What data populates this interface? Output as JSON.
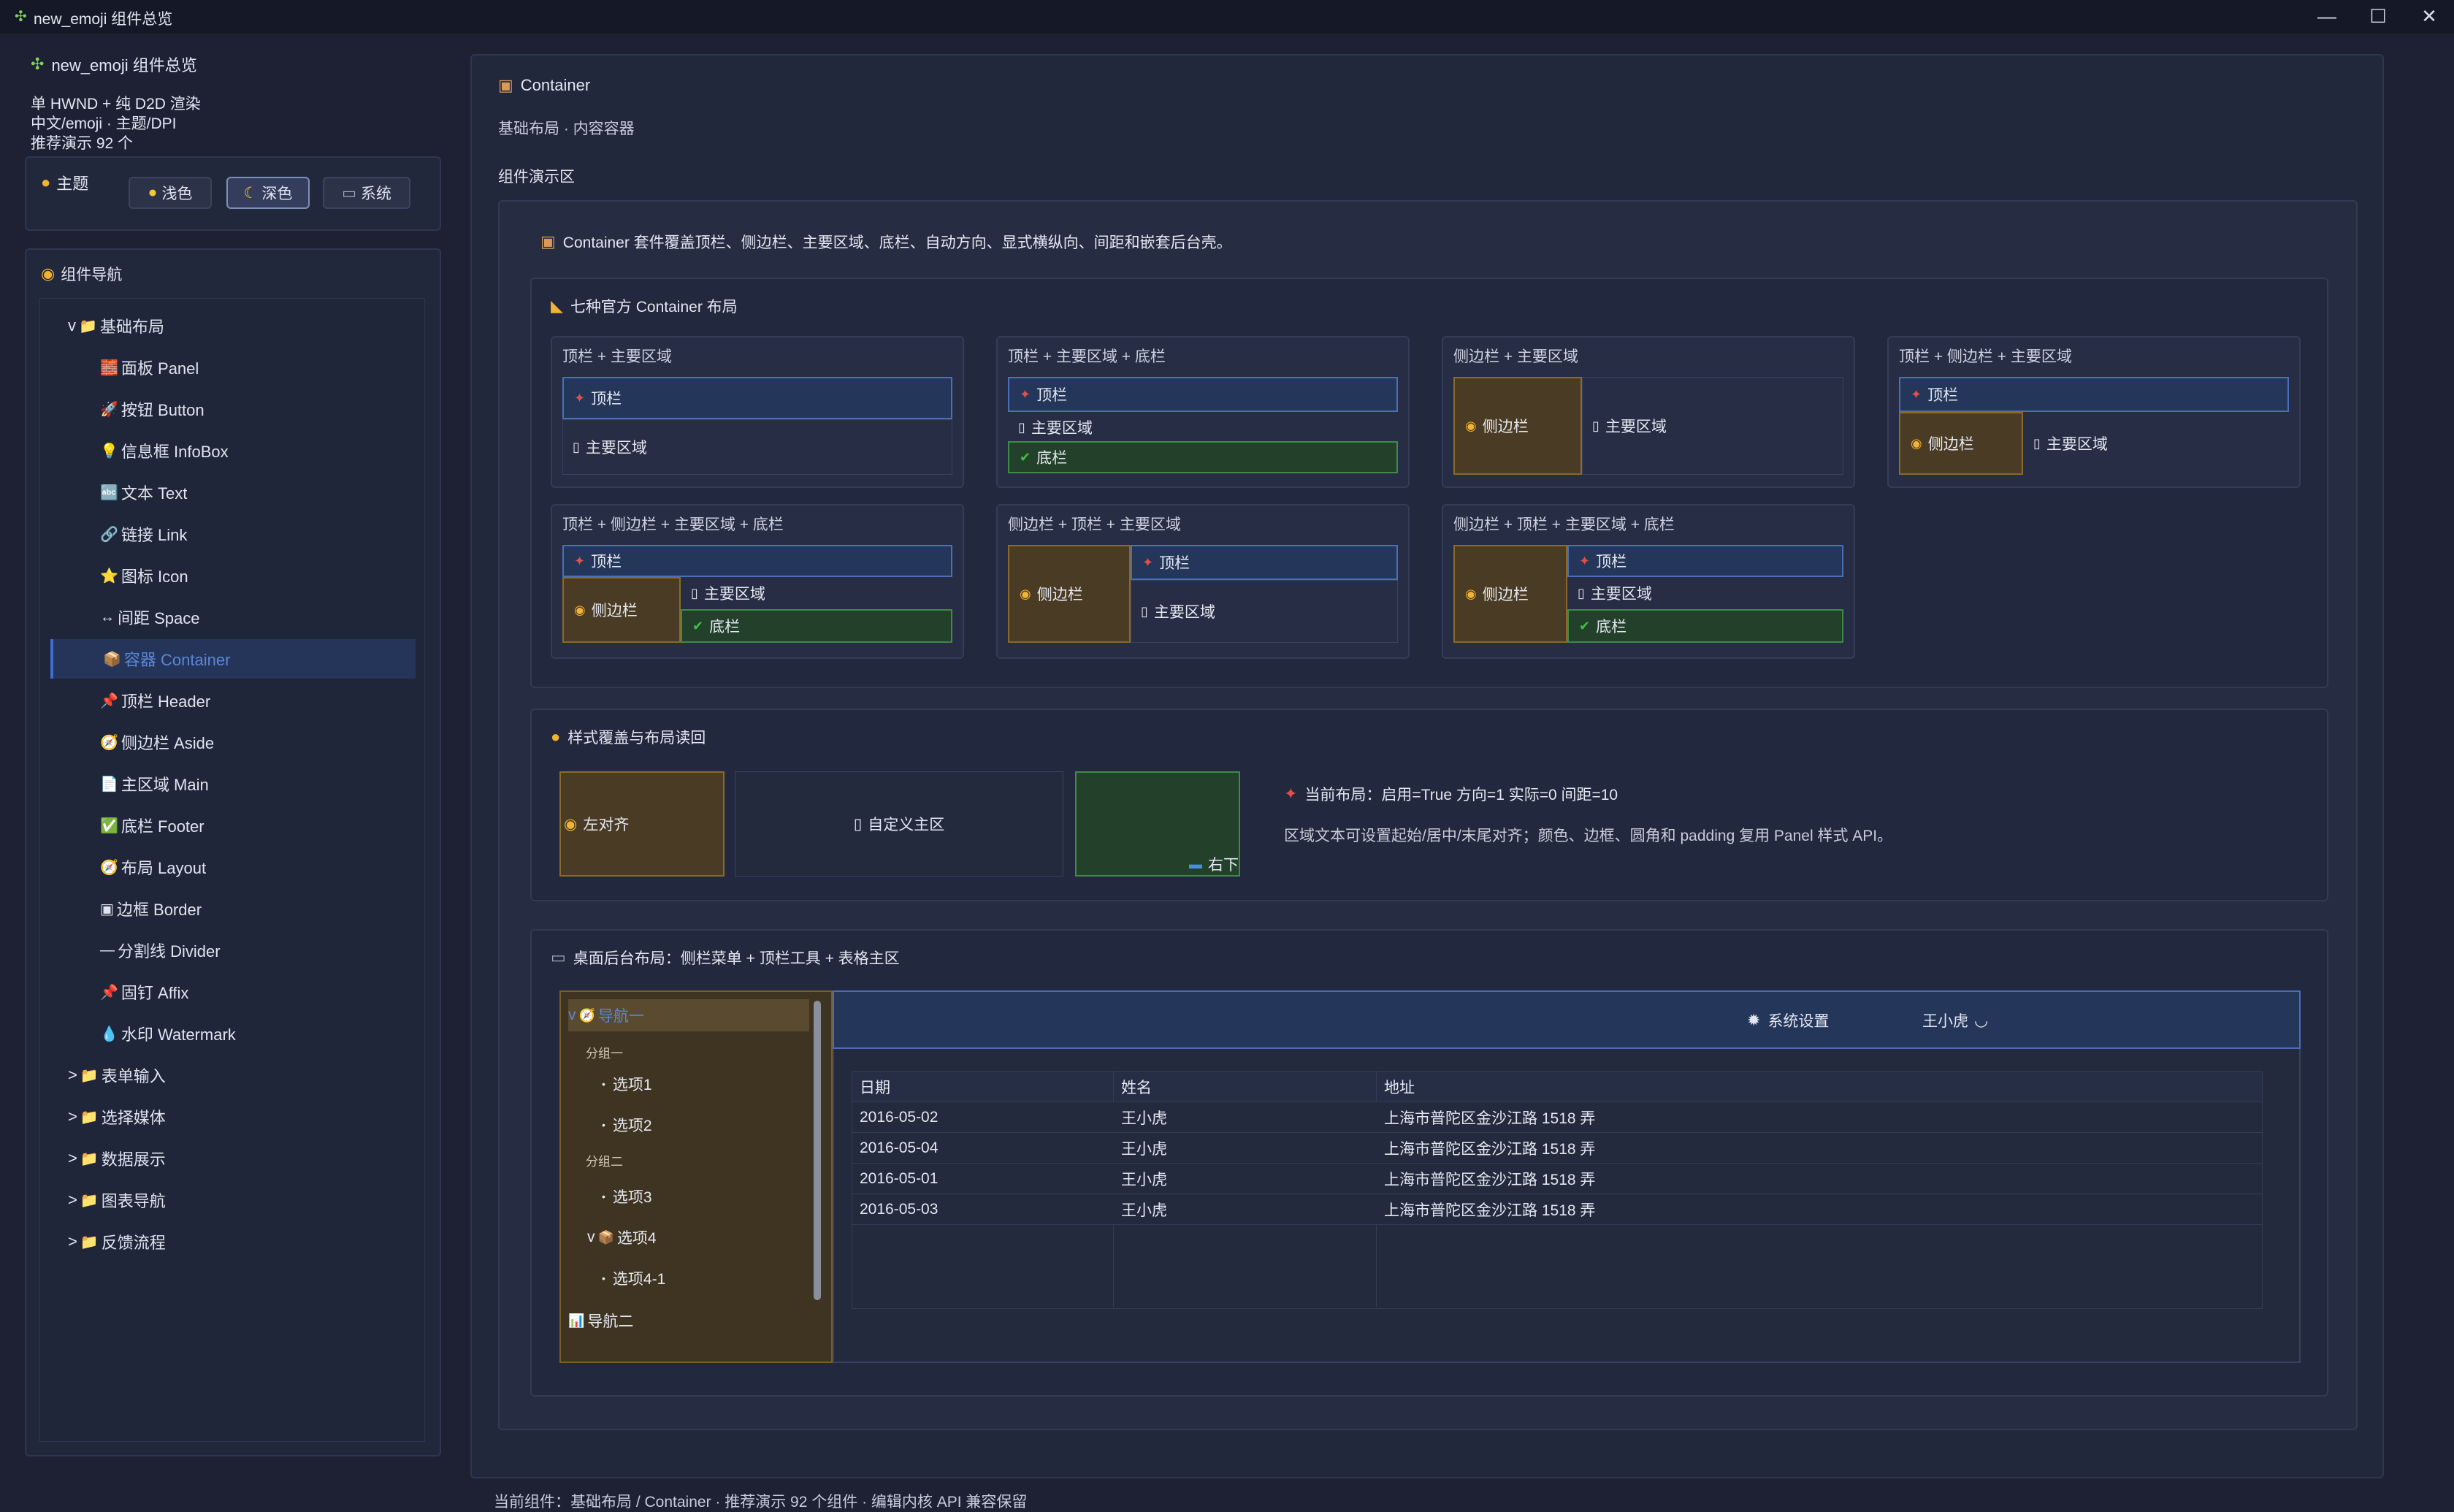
{
  "window": {
    "title": "new_emoji 组件总览",
    "icon": "puzzle-icon",
    "minimize": "—",
    "maximize": "☐",
    "close": "✕"
  },
  "sidebar": {
    "app_title": "new_emoji 组件总览",
    "desc1": "单 HWND + 纯 D2D 渲染",
    "desc2": "中文/emoji · 主题/DPI",
    "desc3": "推荐演示 92 个",
    "theme": {
      "title": "主题",
      "light": "浅色",
      "dark": "深色",
      "system": "系统",
      "selected": "深色"
    },
    "nav_title": "组件导航",
    "nav": [
      {
        "label": "基础布局",
        "prefix": "v",
        "icon": "📁",
        "group": true
      },
      {
        "label": "面板 Panel",
        "icon": "🧱"
      },
      {
        "label": "按钮 Button",
        "icon": "🚀"
      },
      {
        "label": "信息框 InfoBox",
        "icon": "💡"
      },
      {
        "label": "文本 Text",
        "icon": "🔤"
      },
      {
        "label": "链接 Link",
        "icon": "🔗"
      },
      {
        "label": "图标 Icon",
        "icon": "⭐"
      },
      {
        "label": "间距 Space",
        "icon": "↔"
      },
      {
        "label": "容器 Container",
        "icon": "📦",
        "selected": true
      },
      {
        "label": "顶栏 Header",
        "icon": "📌"
      },
      {
        "label": "侧边栏 Aside",
        "icon": "🧭"
      },
      {
        "label": "主区域 Main",
        "icon": "📄"
      },
      {
        "label": "底栏 Footer",
        "icon": "✅"
      },
      {
        "label": "布局 Layout",
        "icon": "🧭"
      },
      {
        "label": "边框 Border",
        "icon": "▣"
      },
      {
        "label": "分割线 Divider",
        "icon": "—"
      },
      {
        "label": "固钉 Affix",
        "icon": "📌"
      },
      {
        "label": "水印 Watermark",
        "icon": "💧"
      },
      {
        "label": "表单输入",
        "prefix": ">",
        "icon": "📁",
        "group": true
      },
      {
        "label": "选择媒体",
        "prefix": ">",
        "icon": "📁",
        "group": true
      },
      {
        "label": "数据展示",
        "prefix": ">",
        "icon": "📁",
        "group": true
      },
      {
        "label": "图表导航",
        "prefix": ">",
        "icon": "📁",
        "group": true
      },
      {
        "label": "反馈流程",
        "prefix": ">",
        "icon": "📁",
        "group": true
      }
    ]
  },
  "main": {
    "title": "Container",
    "subtitle": "基础布局 · 内容容器",
    "demo_title": "组件演示区",
    "intro": "Container 套件覆盖顶栏、侧边栏、主要区域、底栏、自动方向、显式横纵向、间距和嵌套后台壳。",
    "layouts_title": "七种官方 Container 布局",
    "labels": {
      "top": "顶栏",
      "main": "主要区域",
      "aside": "侧边栏",
      "foot": "底栏"
    },
    "layouts": [
      "顶栏 + 主要区域",
      "顶栏 + 主要区域 + 底栏",
      "侧边栏 + 主要区域",
      "顶栏 + 侧边栏 + 主要区域",
      "顶栏 + 侧边栏 + 主要区域 + 底栏",
      "侧边栏 + 顶栏 + 主要区域",
      "侧边栏 + 顶栏 + 主要区域 + 底栏"
    ],
    "style_title": "样式覆盖与布局读回",
    "style": {
      "left_label": "左对齐",
      "center_label": "自定义主区",
      "br_label": "右下",
      "status": "当前布局：启用=True 方向=1 实际=0 间距=10",
      "note": "区域文本可设置起始/居中/末尾对齐；颜色、边框、圆角和 padding 复用 Panel 样式 API。"
    },
    "admin_title": "桌面后台布局：侧栏菜单 + 顶栏工具 + 表格主区",
    "admin": {
      "menu": [
        {
          "label": "导航一",
          "prefix": "v",
          "icon": "🧭",
          "kind": "top",
          "selected": true
        },
        {
          "label": "分组一",
          "kind": "group"
        },
        {
          "label": "选项1",
          "kind": "item"
        },
        {
          "label": "选项2",
          "kind": "item"
        },
        {
          "label": "分组二",
          "kind": "group"
        },
        {
          "label": "选项3",
          "kind": "item"
        },
        {
          "label": "选项4",
          "prefix": "v",
          "icon": "📦",
          "kind": "sub"
        },
        {
          "label": "选项4-1",
          "kind": "item2"
        },
        {
          "label": "导航二",
          "icon": "📊",
          "kind": "top"
        }
      ],
      "settings": "系统设置",
      "user": "王小虎",
      "columns": [
        "日期",
        "姓名",
        "地址"
      ],
      "rows": [
        [
          "2016-05-02",
          "王小虎",
          "上海市普陀区金沙江路 1518 弄"
        ],
        [
          "2016-05-04",
          "王小虎",
          "上海市普陀区金沙江路 1518 弄"
        ],
        [
          "2016-05-01",
          "王小虎",
          "上海市普陀区金沙江路 1518 弄"
        ],
        [
          "2016-05-03",
          "王小虎",
          "上海市普陀区金沙江路 1518 弄"
        ]
      ]
    }
  },
  "status_bar": "当前组件：基础布局 / Container · 推荐演示 92 个组件 · 编辑内核 API 兼容保留"
}
